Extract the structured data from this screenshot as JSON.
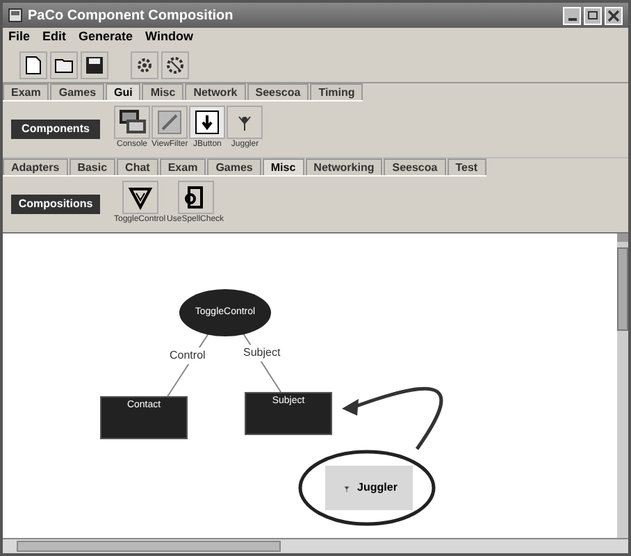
{
  "window": {
    "title": "PaCo Component Composition"
  },
  "menu": [
    "File",
    "Edit",
    "Generate",
    "Window"
  ],
  "components": {
    "label": "Components",
    "tabs": [
      {
        "label": "Exam",
        "selected": false
      },
      {
        "label": "Games",
        "selected": false
      },
      {
        "label": "Gui",
        "selected": true
      },
      {
        "label": "Misc",
        "selected": false
      },
      {
        "label": "Network",
        "selected": false
      },
      {
        "label": "Seescoa",
        "selected": false
      },
      {
        "label": "Timing",
        "selected": false
      }
    ],
    "items": [
      {
        "label": "Console",
        "kind": "console"
      },
      {
        "label": "ViewFilter",
        "kind": "filter"
      },
      {
        "label": "JButton",
        "kind": "button"
      },
      {
        "label": "Juggler",
        "kind": "juggler"
      }
    ]
  },
  "compositions": {
    "label": "Compositions",
    "tabs": [
      {
        "label": "Adapters",
        "selected": false
      },
      {
        "label": "Basic",
        "selected": false
      },
      {
        "label": "Chat",
        "selected": false
      },
      {
        "label": "Exam",
        "selected": false
      },
      {
        "label": "Games",
        "selected": false
      },
      {
        "label": "Misc",
        "selected": true
      },
      {
        "label": "Networking",
        "selected": false
      },
      {
        "label": "Seescoa",
        "selected": false
      },
      {
        "label": "Test",
        "selected": false
      }
    ],
    "items": [
      {
        "label": "ToggleControl",
        "kind": "toggle"
      },
      {
        "label": "UseSpellCheck",
        "kind": "spell"
      }
    ]
  },
  "canvas": {
    "nodes": [
      {
        "label": "ToggleControl",
        "kind": "ellipse"
      },
      {
        "label": "Contact",
        "kind": "box"
      },
      {
        "label": "Subject",
        "kind": "box"
      },
      {
        "label": "Juggler",
        "kind": "component"
      }
    ],
    "edges": [
      {
        "label": "Control"
      },
      {
        "label": "Subject"
      }
    ]
  }
}
